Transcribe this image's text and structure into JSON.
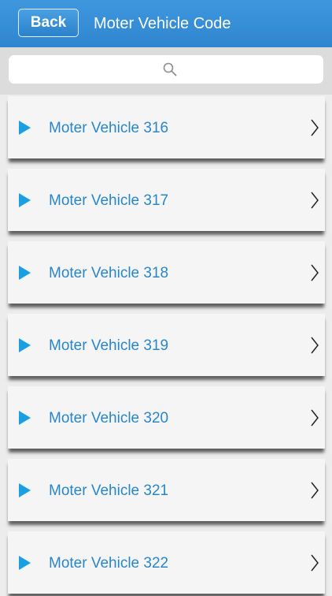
{
  "header": {
    "back_label": "Back",
    "title": "Moter Vehicle Code"
  },
  "search": {
    "placeholder": "",
    "value": ""
  },
  "list": {
    "items": [
      {
        "label": "Moter Vehicle 316"
      },
      {
        "label": "Moter Vehicle 317"
      },
      {
        "label": "Moter Vehicle 318"
      },
      {
        "label": "Moter Vehicle 319"
      },
      {
        "label": "Moter Vehicle 320"
      },
      {
        "label": "Moter Vehicle 321"
      },
      {
        "label": "Moter Vehicle 322"
      }
    ]
  },
  "colors": {
    "navbar": "#2f86cf",
    "item_text": "#2a86c8",
    "play_icon": "#1a9fe3",
    "background": "#ececec"
  },
  "icons": {
    "search": "search-icon",
    "item_marker": "play-icon",
    "item_disclosure": "chevron-right-icon"
  }
}
